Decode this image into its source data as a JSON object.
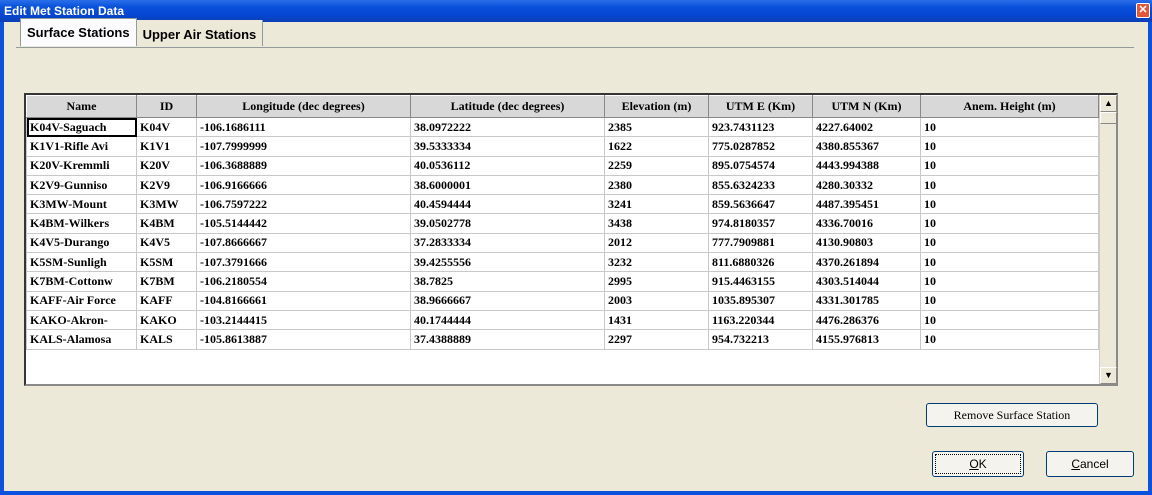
{
  "window": {
    "title": "Edit Met Station Data",
    "close_glyph": "✕"
  },
  "tabs": [
    {
      "label": "Surface Stations",
      "active": true
    },
    {
      "label": "Upper Air Stations",
      "active": false
    }
  ],
  "table": {
    "columns": [
      "Name",
      "ID",
      "Longitude (dec degrees)",
      "Latitude (dec degrees)",
      "Elevation (m)",
      "UTM E (Km)",
      "UTM N (Km)",
      "Anem. Height (m)"
    ],
    "rows": [
      [
        "K04V-Saguach",
        "K04V",
        "-106.1686111",
        "38.0972222",
        "2385",
        "923.7431123",
        "4227.64002",
        "10"
      ],
      [
        "K1V1-Rifle Avi",
        "K1V1",
        "-107.7999999",
        "39.5333334",
        "1622",
        "775.0287852",
        "4380.855367",
        "10"
      ],
      [
        "K20V-Kremmli",
        "K20V",
        "-106.3688889",
        "40.0536112",
        "2259",
        "895.0754574",
        "4443.994388",
        "10"
      ],
      [
        "K2V9-Gunniso",
        "K2V9",
        "-106.9166666",
        "38.6000001",
        "2380",
        "855.6324233",
        "4280.30332",
        "10"
      ],
      [
        "K3MW-Mount",
        "K3MW",
        "-106.7597222",
        "40.4594444",
        "3241",
        "859.5636647",
        "4487.395451",
        "10"
      ],
      [
        "K4BM-Wilkers",
        "K4BM",
        "-105.5144442",
        "39.0502778",
        "3438",
        "974.8180357",
        "4336.70016",
        "10"
      ],
      [
        "K4V5-Durango",
        "K4V5",
        "-107.8666667",
        "37.2833334",
        "2012",
        "777.7909881",
        "4130.90803",
        "10"
      ],
      [
        "K5SM-Sunligh",
        "K5SM",
        "-107.3791666",
        "39.4255556",
        "3232",
        "811.6880326",
        "4370.261894",
        "10"
      ],
      [
        "K7BM-Cottonw",
        "K7BM",
        "-106.2180554",
        "38.7825",
        "2995",
        "915.4463155",
        "4303.514044",
        "10"
      ],
      [
        "KAFF-Air Force",
        "KAFF",
        "-104.8166661",
        "38.9666667",
        "2003",
        "1035.895307",
        "4331.301785",
        "10"
      ],
      [
        "KAKO-Akron-",
        "KAKO",
        "-103.2144415",
        "40.1744444",
        "1431",
        "1163.220344",
        "4476.286376",
        "10"
      ],
      [
        "KALS-Alamosa",
        "KALS",
        "-105.8613887",
        "37.4388889",
        "2297",
        "954.732213",
        "4155.976813",
        "10"
      ]
    ]
  },
  "scrollbar": {
    "up_glyph": "▲",
    "down_glyph": "▼"
  },
  "buttons": {
    "remove": "Remove Surface Station",
    "ok_mnemonic": "O",
    "ok_rest": "K",
    "cancel_mnemonic": "C",
    "cancel_rest": "ancel"
  }
}
